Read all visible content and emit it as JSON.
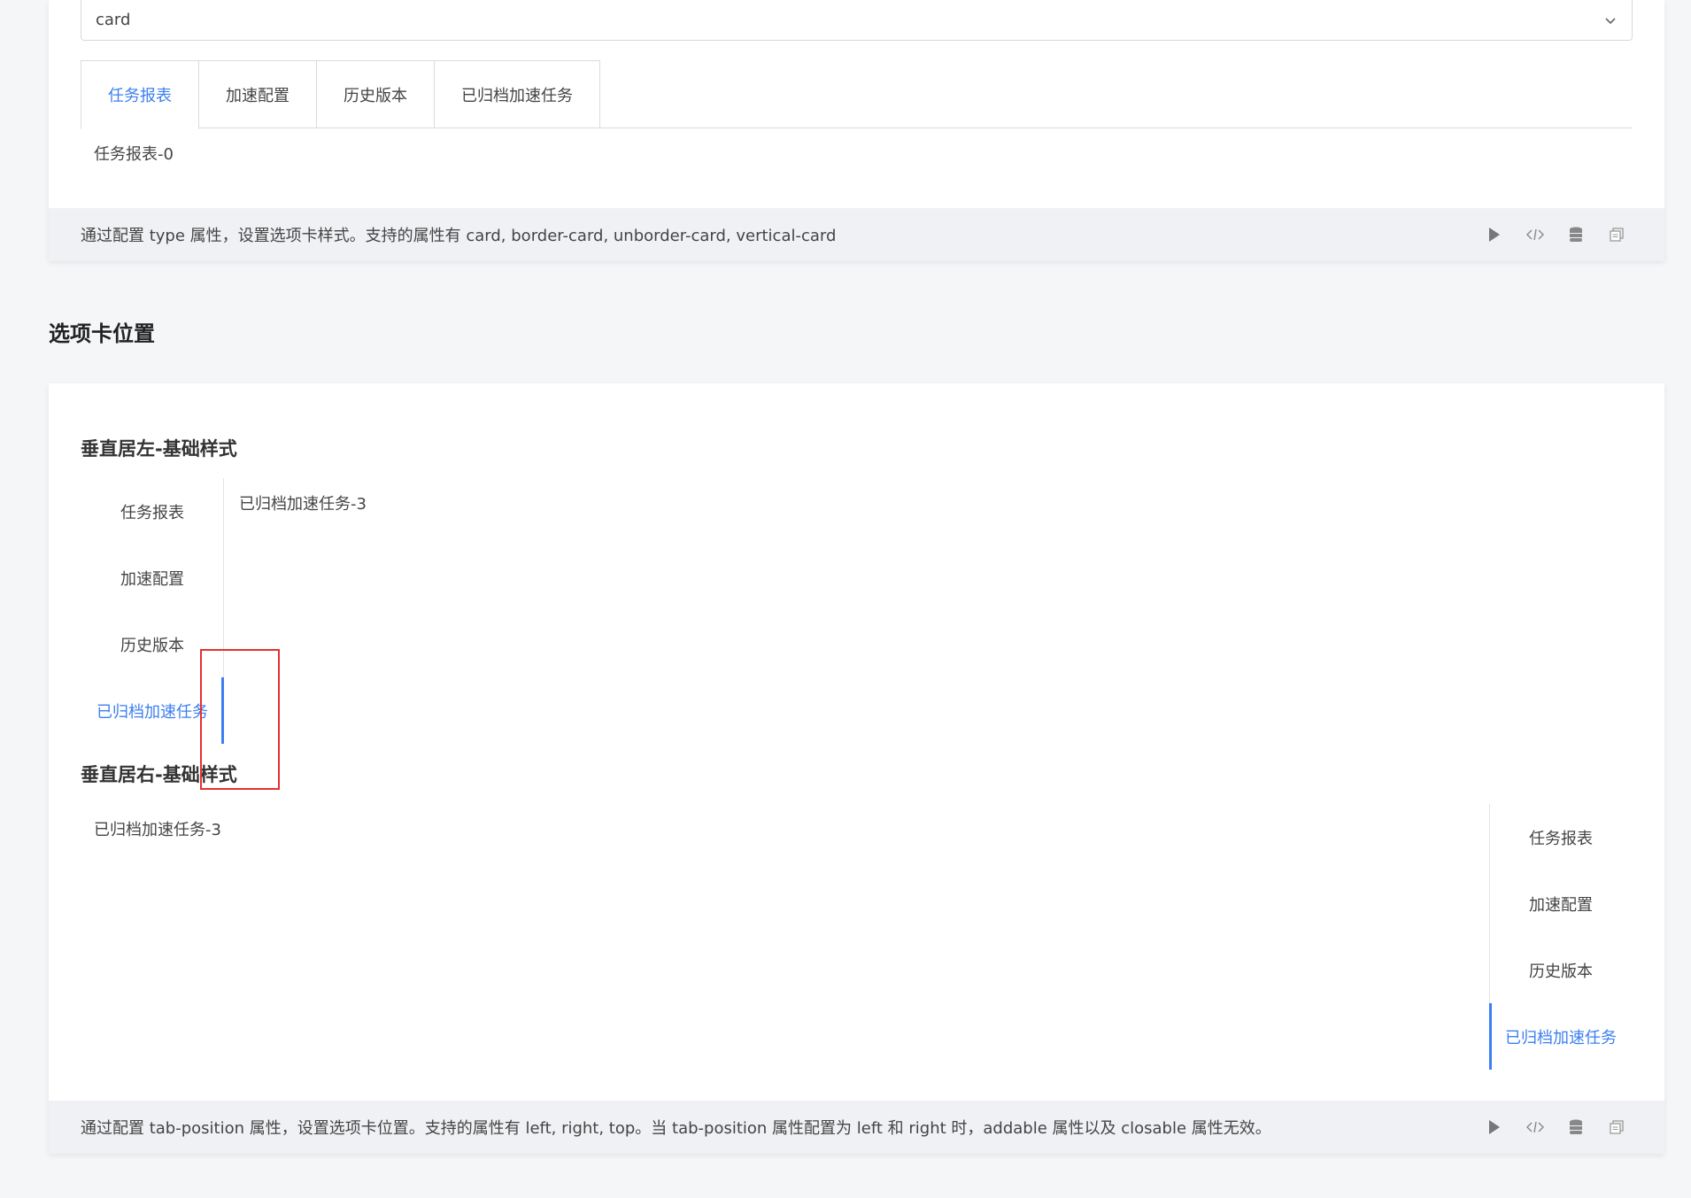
{
  "top_card": {
    "select_value": "card",
    "tabs": [
      {
        "label": "任务报表",
        "active": true
      },
      {
        "label": "加速配置",
        "active": false
      },
      {
        "label": "历史版本",
        "active": false
      },
      {
        "label": "已归档加速任务",
        "active": false
      }
    ],
    "tab_content": "任务报表-0",
    "description": "通过配置 type 属性，设置选项卡样式。支持的属性有 card, border-card, unborder-card, vertical-card"
  },
  "section": {
    "title": "选项卡位置"
  },
  "position_card": {
    "left_title": "垂直居左-基础样式",
    "left_tabs": [
      {
        "label": "任务报表",
        "active": false
      },
      {
        "label": "加速配置",
        "active": false
      },
      {
        "label": "历史版本",
        "active": false
      },
      {
        "label": "已归档加速任务",
        "active": true
      }
    ],
    "left_content": "已归档加速任务-3",
    "right_title": "垂直居右-基础样式",
    "right_tabs": [
      {
        "label": "任务报表",
        "active": false
      },
      {
        "label": "加速配置",
        "active": false
      },
      {
        "label": "历史版本",
        "active": false
      },
      {
        "label": "已归档加速任务",
        "active": true
      }
    ],
    "right_content": "已归档加速任务-3",
    "description": "通过配置 tab-position 属性，设置选项卡位置。支持的属性有 left, right, top。当 tab-position 属性配置为 left 和 right 时，addable 属性以及 closable 属性无效。"
  },
  "footer_icons": [
    "play-icon",
    "code-icon",
    "database-icon",
    "copy-icon"
  ],
  "colors": {
    "accent": "#3c7ff0",
    "highlight": "#e53030",
    "footer_bg": "#f0f1f4",
    "page_bg": "#f5f6f8"
  }
}
